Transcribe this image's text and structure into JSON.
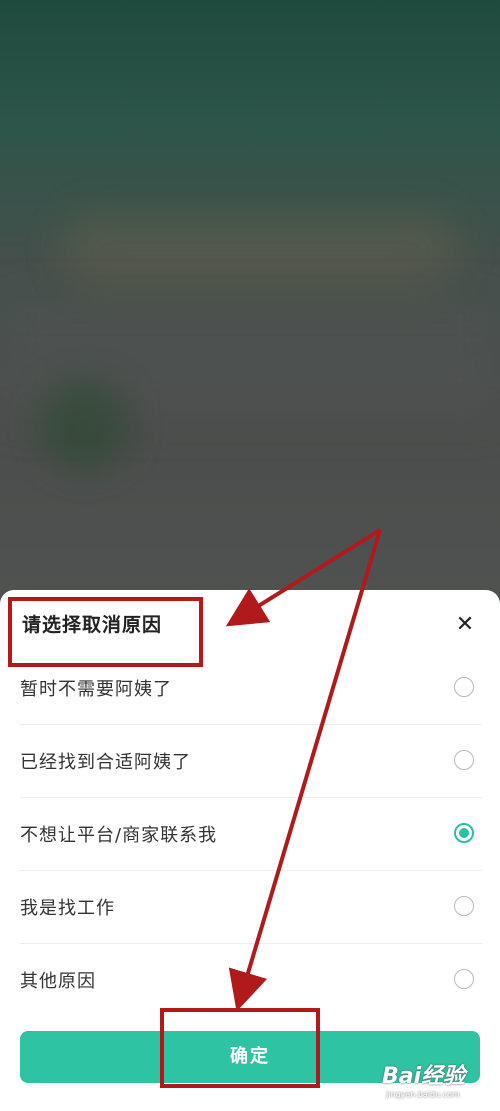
{
  "sheet": {
    "title": "请选择取消原因",
    "close_glyph": "✕",
    "options": [
      {
        "label": "暂时不需要阿姨了",
        "checked": false
      },
      {
        "label": "已经找到合适阿姨了",
        "checked": false
      },
      {
        "label": "不想让平台/商家联系我",
        "checked": true
      },
      {
        "label": "我是找工作",
        "checked": false
      },
      {
        "label": "其他原因",
        "checked": false
      }
    ],
    "confirm_label": "确定"
  },
  "watermark": {
    "logo": "Bai经验",
    "sub": "jingyan.baidu.com"
  },
  "colors": {
    "accent": "#2ec4a3",
    "annotation": "#b01a1a"
  }
}
